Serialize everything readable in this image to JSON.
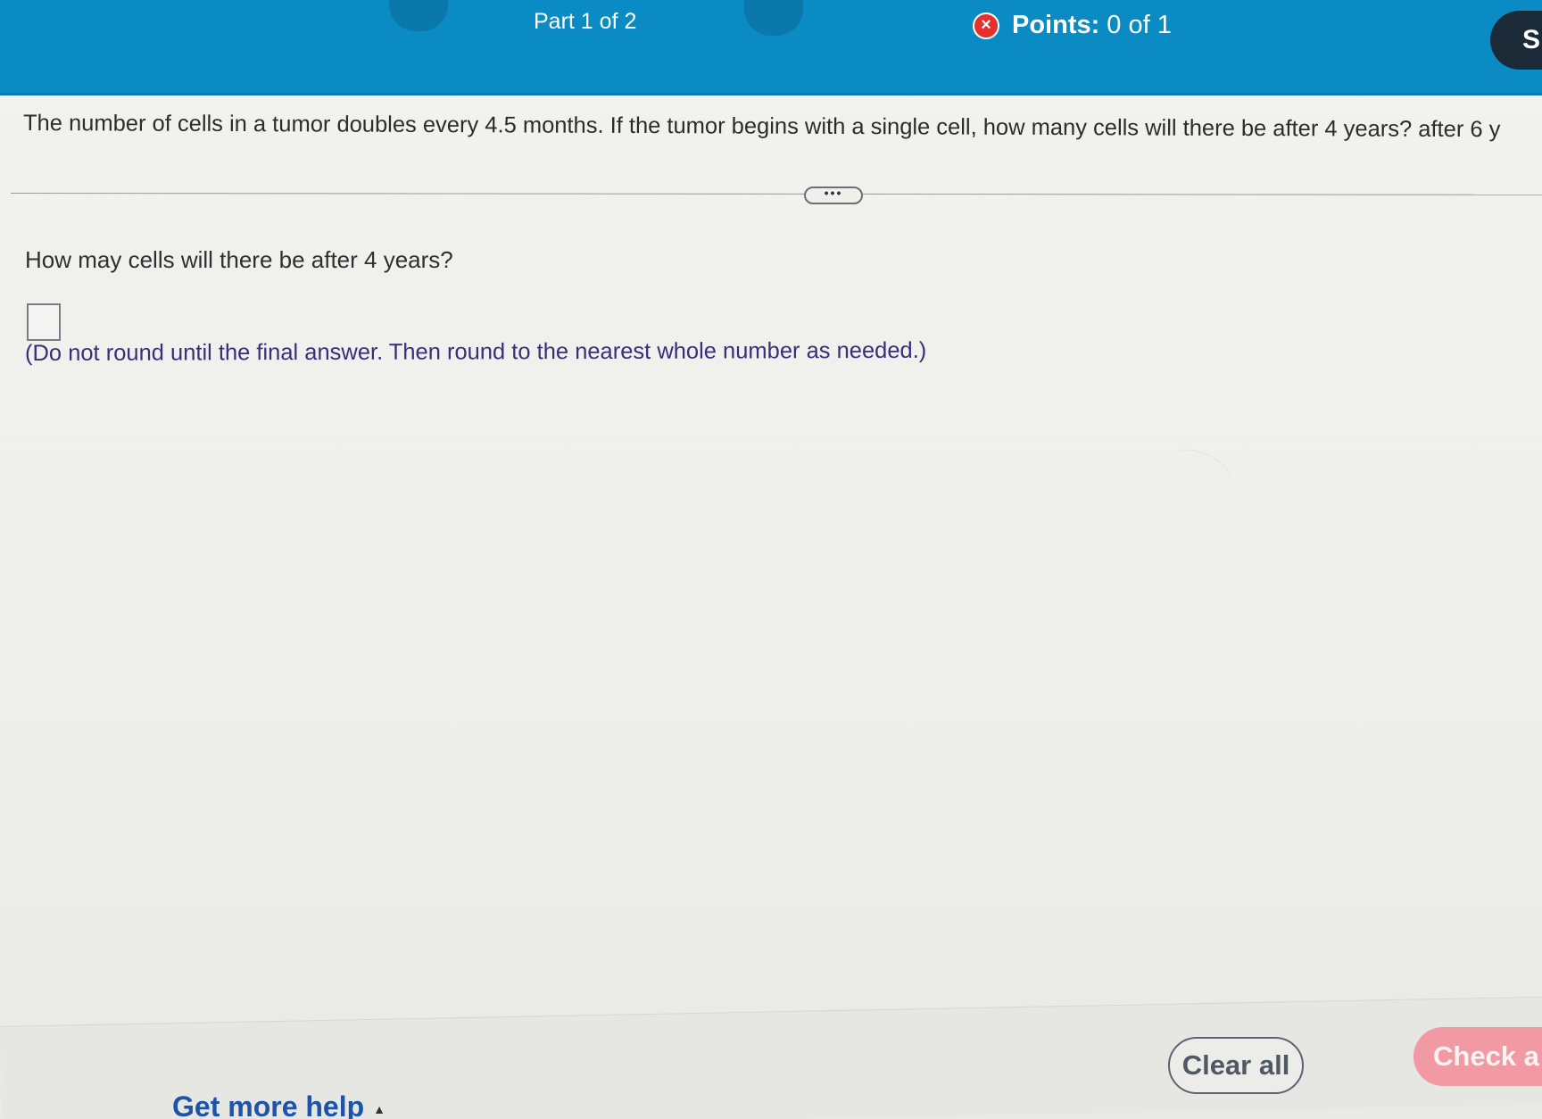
{
  "header": {
    "prev_icon": "‹",
    "next_icon": "›",
    "part_label": "Part 1 of 2",
    "points_icon": "×",
    "points_label": "Points:",
    "points_value": "0 of 1",
    "save_label": "S"
  },
  "question": {
    "text": "The number of cells in a tumor doubles every 4.5 months. If the tumor begins with a single cell, how many cells will there be after 4 years? after 6 y",
    "expand_label": "•••",
    "subquestion": "How may cells will there be after 4 years?",
    "answer_value": "",
    "note": "(Do not round until the final answer. Then round to the nearest whole number as needed.)"
  },
  "footer": {
    "help_label": "Get more help",
    "help_caret": "▲",
    "clear_label": "Clear all",
    "check_label": "Check a"
  },
  "colors": {
    "header_bg": "#0b8bc4",
    "points_icon": "#e5302e",
    "link": "#1b54a8",
    "note_text": "#36307a",
    "check_button": "#f19aa4"
  }
}
